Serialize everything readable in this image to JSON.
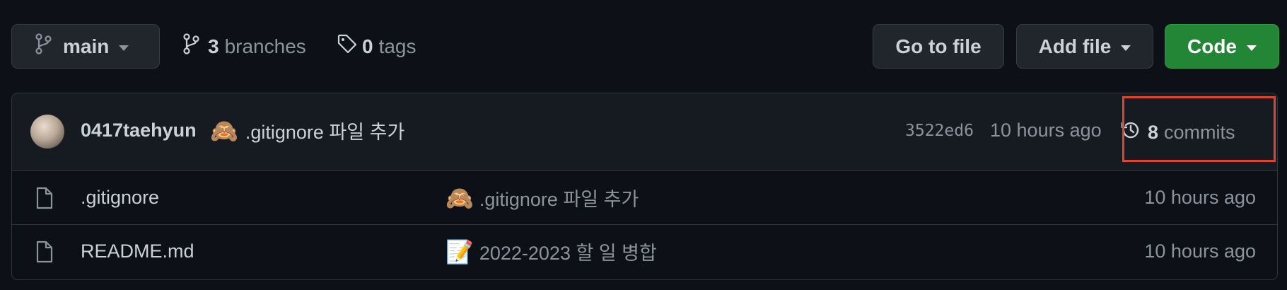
{
  "toolbar": {
    "branch": {
      "label": "main",
      "icon": "git-branch-icon"
    },
    "branches": {
      "count": "3",
      "label": "branches",
      "icon": "git-branch-icon"
    },
    "tags": {
      "count": "0",
      "label": "tags",
      "icon": "tag-icon"
    },
    "go_to_file_label": "Go to file",
    "add_file_label": "Add file",
    "code_label": "Code"
  },
  "latest_commit": {
    "author": "0417taehyun",
    "emoji": "🙈",
    "message": ".gitignore 파일 추가",
    "sha": "3522ed6",
    "time": "10 hours ago",
    "commits_count": "8",
    "commits_label": "commits"
  },
  "files": [
    {
      "name": ".gitignore",
      "commit_emoji": "🙈",
      "commit_message": ".gitignore 파일 추가",
      "time": "10 hours ago",
      "icon": "file-icon"
    },
    {
      "name": "README.md",
      "commit_emoji": "📝",
      "commit_message": "2022-2023 할 일 병합",
      "time": "10 hours ago",
      "icon": "file-icon"
    }
  ],
  "colors": {
    "background": "#0d1117",
    "header_background": "#161b22",
    "button_background": "#21262d",
    "code_button": "#238636",
    "highlight": "#e0442f",
    "muted_text": "#8b949e"
  }
}
